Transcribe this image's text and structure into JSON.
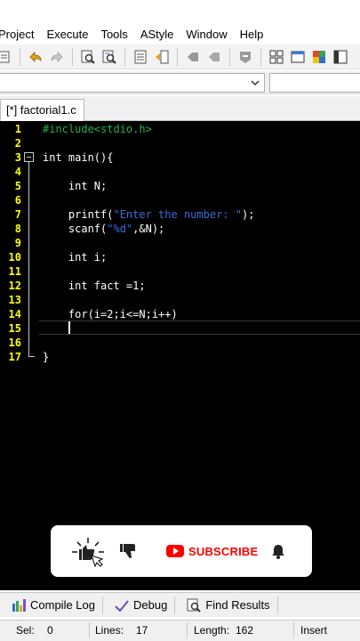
{
  "menu": [
    "Project",
    "Execute",
    "Tools",
    "AStyle",
    "Window",
    "Help"
  ],
  "toolbar_icons": [
    "open-file-icon",
    "undo-icon",
    "redo-icon",
    "find-icon",
    "replace-icon",
    "toggle-comment-icon",
    "indent-icon",
    "compile-icon",
    "run-icon",
    "stop-icon",
    "new-class-icon",
    "layout-grid-icon",
    "window-icon",
    "palette-icon",
    "tile-icon"
  ],
  "file_tab": {
    "label": "[*] factorial1.c"
  },
  "editor": {
    "lines": [
      {
        "n": "1",
        "text": "#include<stdio.h>"
      },
      {
        "n": "2",
        "text": ""
      },
      {
        "n": "3",
        "text": "int main(){"
      },
      {
        "n": "4",
        "text": ""
      },
      {
        "n": "5",
        "text": "    int N;"
      },
      {
        "n": "6",
        "text": ""
      },
      {
        "n": "7",
        "text": "    printf(\"Enter the number: \");"
      },
      {
        "n": "8",
        "text": "    scanf(\"%d\",&N);"
      },
      {
        "n": "9",
        "text": ""
      },
      {
        "n": "10",
        "text": "    int i;"
      },
      {
        "n": "11",
        "text": ""
      },
      {
        "n": "12",
        "text": "    int fact =1;"
      },
      {
        "n": "13",
        "text": ""
      },
      {
        "n": "14",
        "text": "    for(i=2;i<=N;i++)"
      },
      {
        "n": "15",
        "text": "    "
      },
      {
        "n": "16",
        "text": ""
      },
      {
        "n": "17",
        "text": "}"
      }
    ],
    "current_line": 15,
    "colors": {
      "background": "#000000",
      "line_numbers": "#ffff00",
      "preprocessor": "#22b14c",
      "string": "#3b6dd6",
      "text": "#ffffff"
    }
  },
  "overlay": {
    "subscribe_label": "SUBSCRIBE",
    "accent": "#ff0000"
  },
  "bottom_tabs": [
    {
      "label": "Compile Log",
      "icon": "compile-log-icon"
    },
    {
      "label": "Debug",
      "icon": "debug-check-icon"
    },
    {
      "label": "Find Results",
      "icon": "find-results-icon"
    }
  ],
  "status": {
    "sel_label": "Sel:",
    "sel_value": "0",
    "lines_label": "Lines:",
    "lines_value": "17",
    "length_label": "Length:",
    "length_value": "162",
    "mode": "Insert"
  }
}
